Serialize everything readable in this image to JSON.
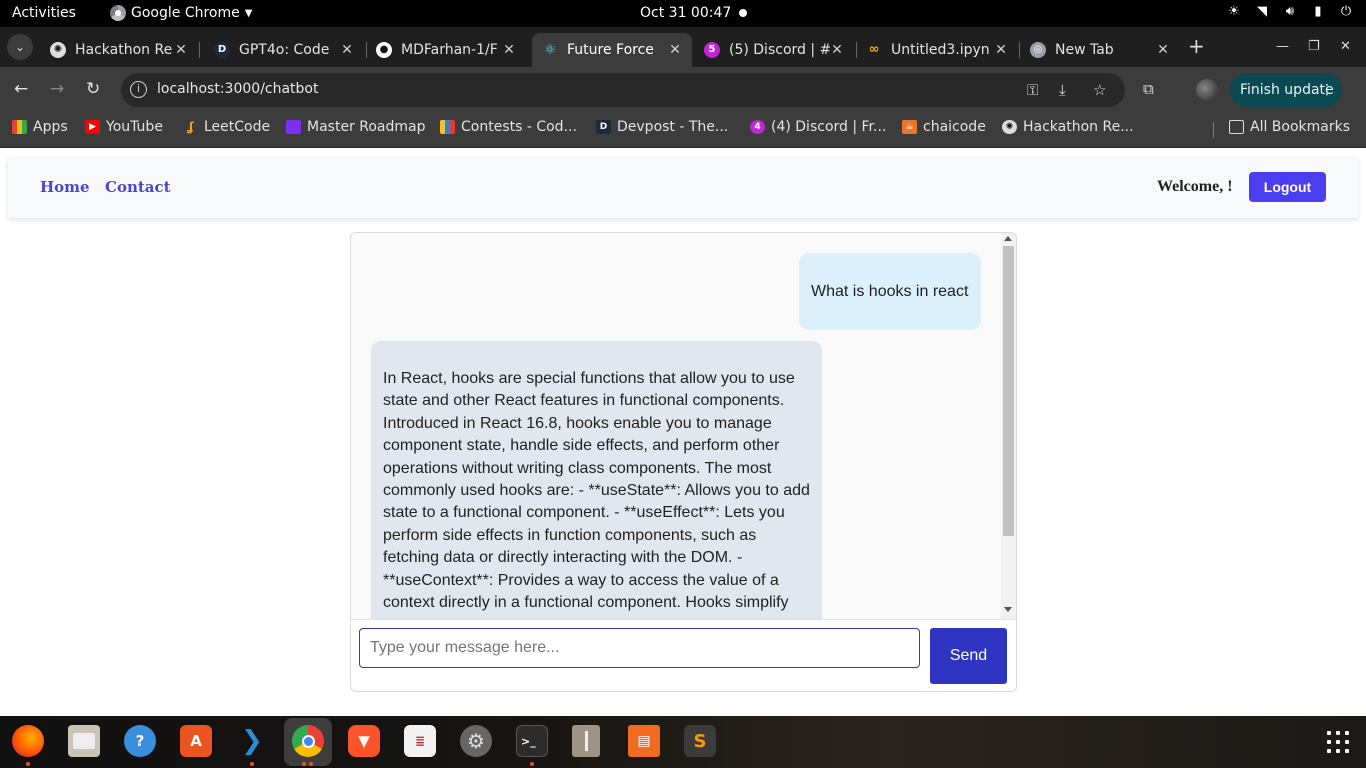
{
  "system": {
    "activities": "Activities",
    "app_name": "Google Chrome",
    "clock": "Oct 31  00:47"
  },
  "browser": {
    "tabs": [
      {
        "label": "Hackathon Re",
        "icon": "openai-icon",
        "active": false
      },
      {
        "label": "GPT4o: Code",
        "icon": "devpost-icon",
        "active": false
      },
      {
        "label": "MDFarhan-1/F",
        "icon": "github-icon",
        "active": false
      },
      {
        "label": "Future Force",
        "icon": "react-icon",
        "active": true
      },
      {
        "label": "(5) Discord | #",
        "icon": "discord-icon",
        "active": false
      },
      {
        "label": "Untitled3.ipyn",
        "icon": "colab-icon",
        "active": false
      },
      {
        "label": "New Tab",
        "icon": "chrome-icon",
        "active": false
      }
    ],
    "url": "localhost:3000/chatbot",
    "finish_update": "Finish update",
    "bookmarks": [
      {
        "label": "Apps",
        "icon": "apps-grid-icon"
      },
      {
        "label": "YouTube",
        "icon": "youtube-icon"
      },
      {
        "label": "LeetCode",
        "icon": "leetcode-icon"
      },
      {
        "label": "Master Roadmap",
        "icon": "roadmap-icon"
      },
      {
        "label": "Contests - Cod...",
        "icon": "codeforces-icon"
      },
      {
        "label": "Devpost - The...",
        "icon": "devpost-icon"
      },
      {
        "label": "(4) Discord | Fr...",
        "icon": "discord-icon"
      },
      {
        "label": "chaicode",
        "icon": "chaicode-icon"
      },
      {
        "label": "Hackathon Re...",
        "icon": "openai-icon"
      }
    ],
    "all_bookmarks": "All Bookmarks"
  },
  "app": {
    "nav": {
      "home": "Home",
      "contact": "Contact",
      "welcome": "Welcome, !",
      "logout": "Logout"
    },
    "chat": {
      "user_message": "What is hooks in react",
      "bot_message": "In React, hooks are special functions that allow you to use state and other React features in functional components. Introduced in React 16.8, hooks enable you to manage component state, handle side effects, and perform other operations without writing class components. The most commonly used hooks are: - **useState**: Allows you to add state to a functional component. - **useEffect**: Lets you perform side effects in function components, such as fetching data or directly interacting with the DOM. - **useContext**: Provides a way to access the value of a context directly in a functional component. Hooks simplify",
      "input_placeholder": "Type your message here...",
      "input_value": "",
      "send": "Send"
    }
  },
  "dock": {
    "apps": [
      "firefox-icon",
      "files-icon",
      "help-icon",
      "app-center-icon",
      "vscode-icon",
      "chrome-icon",
      "brave-icon",
      "text-editor-icon",
      "settings-icon",
      "terminal-icon",
      "archive-icon",
      "libreoffice-impress-icon",
      "sublime-text-icon"
    ]
  },
  "colors": {
    "accent": "#4a3ef0",
    "nav_link": "#4a47c9",
    "send_button": "#2f35c2",
    "user_bubble": "#dcf0fb",
    "bot_bubble": "#e1e7ef"
  }
}
